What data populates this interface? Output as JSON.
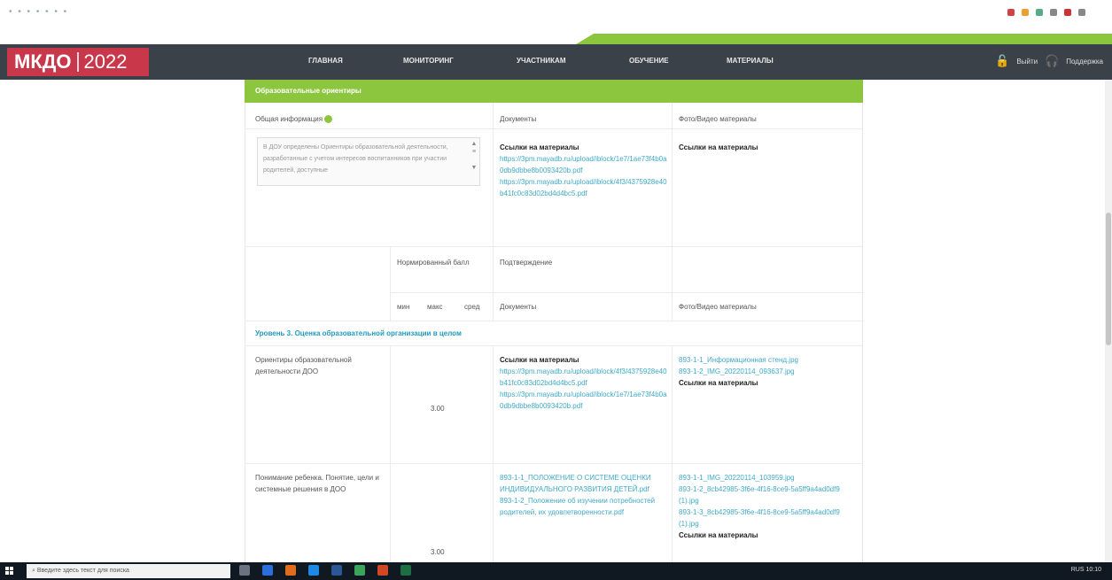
{
  "nav": {
    "logo_main": "МКДО",
    "logo_year": "2022",
    "items": [
      "ГЛАВНАЯ",
      "МОНИТОРИНГ",
      "УЧАСТНИКАМ",
      "ОБУЧЕНИЕ",
      "МАТЕРИАЛЫ"
    ],
    "logout": "Выйти",
    "support": "Поддержка"
  },
  "section": {
    "title": "Образовательные ориентиры"
  },
  "general": {
    "label": "Общая информация",
    "documents_header": "Документы",
    "photo_header": "Фото/Видео материалы",
    "textarea_value": "В ДОУ определены Ориентиры образовательной деятельности, разработанные с учетом интересов воспитанников при участии родителей, доступные",
    "doc_links_title": "Ссылки на материалы",
    "doc_links": [
      "https://3pm.mayadb.ru/upload/iblock/1e7/1ae73f4b0a0db9dbbe8b0093420b.pdf",
      "https://3pm.mayadb.ru/upload/iblock/4f3/4375928e40b41fc0c83d02bd4d4bc5.pdf"
    ],
    "photo_links_title": "Ссылки на материалы"
  },
  "table_header": {
    "normalized_score": "Нормированный балл",
    "confirmation": "Подтверждение",
    "min": "мин",
    "max": "макс",
    "avg": "сред",
    "documents": "Документы",
    "photo": "Фото/Видео материалы"
  },
  "level3": {
    "title": "Уровень 3. Оценка образовательной организации в целом",
    "rows": [
      {
        "name": "Ориентиры образовательной деятельности ДОО",
        "score": "3.00",
        "doc_title": "Ссылки на материалы",
        "doc_links": [
          "https://3pm.mayadb.ru/upload/iblock/4f3/4375928e40b41fc0c83d02bd4d4bc5.pdf",
          "https://3pm.mayadb.ru/upload/iblock/1e7/1ae73f4b0a0db9dbbe8b0093420b.pdf"
        ],
        "photo_links": [
          "893-1-1_Информационная стенд.jpg",
          "893-1-2_IMG_20220114_093637.jpg"
        ],
        "photo_title": "Ссылки на материалы"
      },
      {
        "name": "Понимание ребенка. Понятие, цели и системные решения в ДОО",
        "score": "3.00",
        "doc_links": [
          "893-1-1_ПОЛОЖЕНИЕ О СИСТЕМЕ ОЦЕНКИ ИНДИВИДУАЛЬНОГО РАЗВИТИЯ ДЕТЕЙ.pdf",
          "893-1-2_Положение об изучении потребностей родителей, их удовлетворенности.pdf"
        ],
        "photo_links": [
          "893-1-1_IMG_20220114_103959.jpg",
          "893-1-2_8cb42985-3f6e-4f16-8ce9-5a5ff9a4ad0df9 (1).jpg",
          "893-1-3_8cb42985-3f6e-4f16-8ce9-5a5ff9a4ad0df9 (1).jpg"
        ],
        "photo_title": "Ссылки на материалы"
      }
    ]
  },
  "taskbar": {
    "search_placeholder": "Введите здесь текст для поиска",
    "tray": "RUS  10:10"
  }
}
